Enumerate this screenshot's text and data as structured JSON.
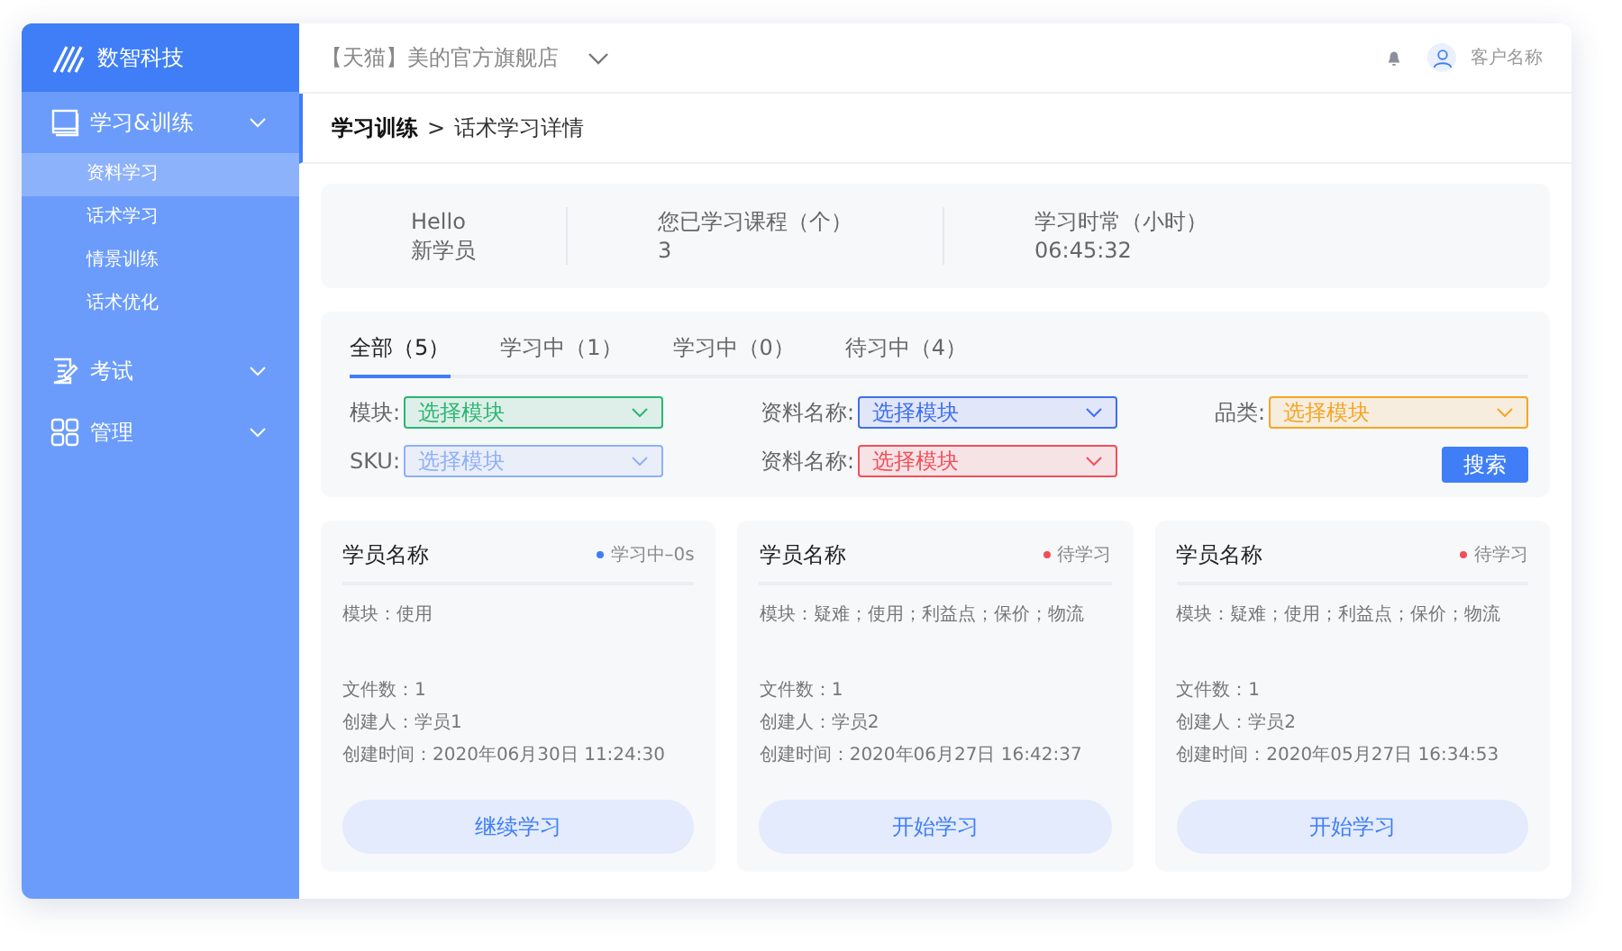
{
  "logo": {
    "name": "数智科技"
  },
  "sidebar": {
    "groups": [
      {
        "label": "学习&训练",
        "children": [
          {
            "label": "资料学习",
            "selected": true
          },
          {
            "label": "话术学习",
            "selected": false
          },
          {
            "label": "情景训练",
            "selected": false
          },
          {
            "label": "话术优化",
            "selected": false
          }
        ]
      },
      {
        "label": "考试"
      },
      {
        "label": "管理"
      }
    ]
  },
  "header": {
    "store": "【天猫】美的官方旗舰店",
    "user": "客户名称"
  },
  "breadcrumb": {
    "parent": "学习训练",
    "separator": ">",
    "current": "话术学习详情"
  },
  "stats": [
    {
      "label": "Hello",
      "value": "新学员"
    },
    {
      "label": "您已学习课程（个）",
      "value": "3"
    },
    {
      "label": "学习时常（小时）",
      "value": "06:45:32"
    }
  ],
  "tabs": [
    {
      "label": "全部（5）",
      "selected": true
    },
    {
      "label": "学习中（1）",
      "selected": false
    },
    {
      "label": "学习中（0）",
      "selected": false
    },
    {
      "label": "待习中（4）",
      "selected": false
    }
  ],
  "filters": [
    {
      "label": "模块:",
      "placeholder": "选择模块",
      "color": "#2bb673"
    },
    {
      "label": "资料名称:",
      "placeholder": "选择模块",
      "color": "#3f6ff0"
    },
    {
      "label": "品类:",
      "placeholder": "选择模块",
      "color": "#f5a623"
    },
    {
      "label": "SKU:",
      "placeholder": "选择模块",
      "color": "#8fb0f8"
    },
    {
      "label": "资料名称:",
      "placeholder": "选择模块",
      "color": "#f0505a"
    }
  ],
  "search_button": "搜索",
  "cards": [
    {
      "name": "学员名称",
      "status": "学习中–0s",
      "color": "#3f7ef7",
      "module": "模块：使用",
      "files": "文件数：1",
      "creator": "创建人：学员1",
      "created": "创建时间：2020年06月30日 11:24:30",
      "button": "继续学习"
    },
    {
      "name": "学员名称",
      "status": "待学习",
      "color": "#f0505a",
      "module": "模块：疑难；使用；利益点；保价；物流",
      "files": "文件数：1",
      "creator": "创建人：学员2",
      "created": "创建时间：2020年06月27日 16:42:37",
      "button": "开始学习"
    },
    {
      "name": "学员名称",
      "status": "待学习",
      "color": "#f0505a",
      "module": "模块：疑难；使用；利益点；保价；物流",
      "files": "文件数：1",
      "creator": "创建人：学员2",
      "created": "创建时间：2020年05月27日 16:34:53",
      "button": "开始学习"
    }
  ]
}
